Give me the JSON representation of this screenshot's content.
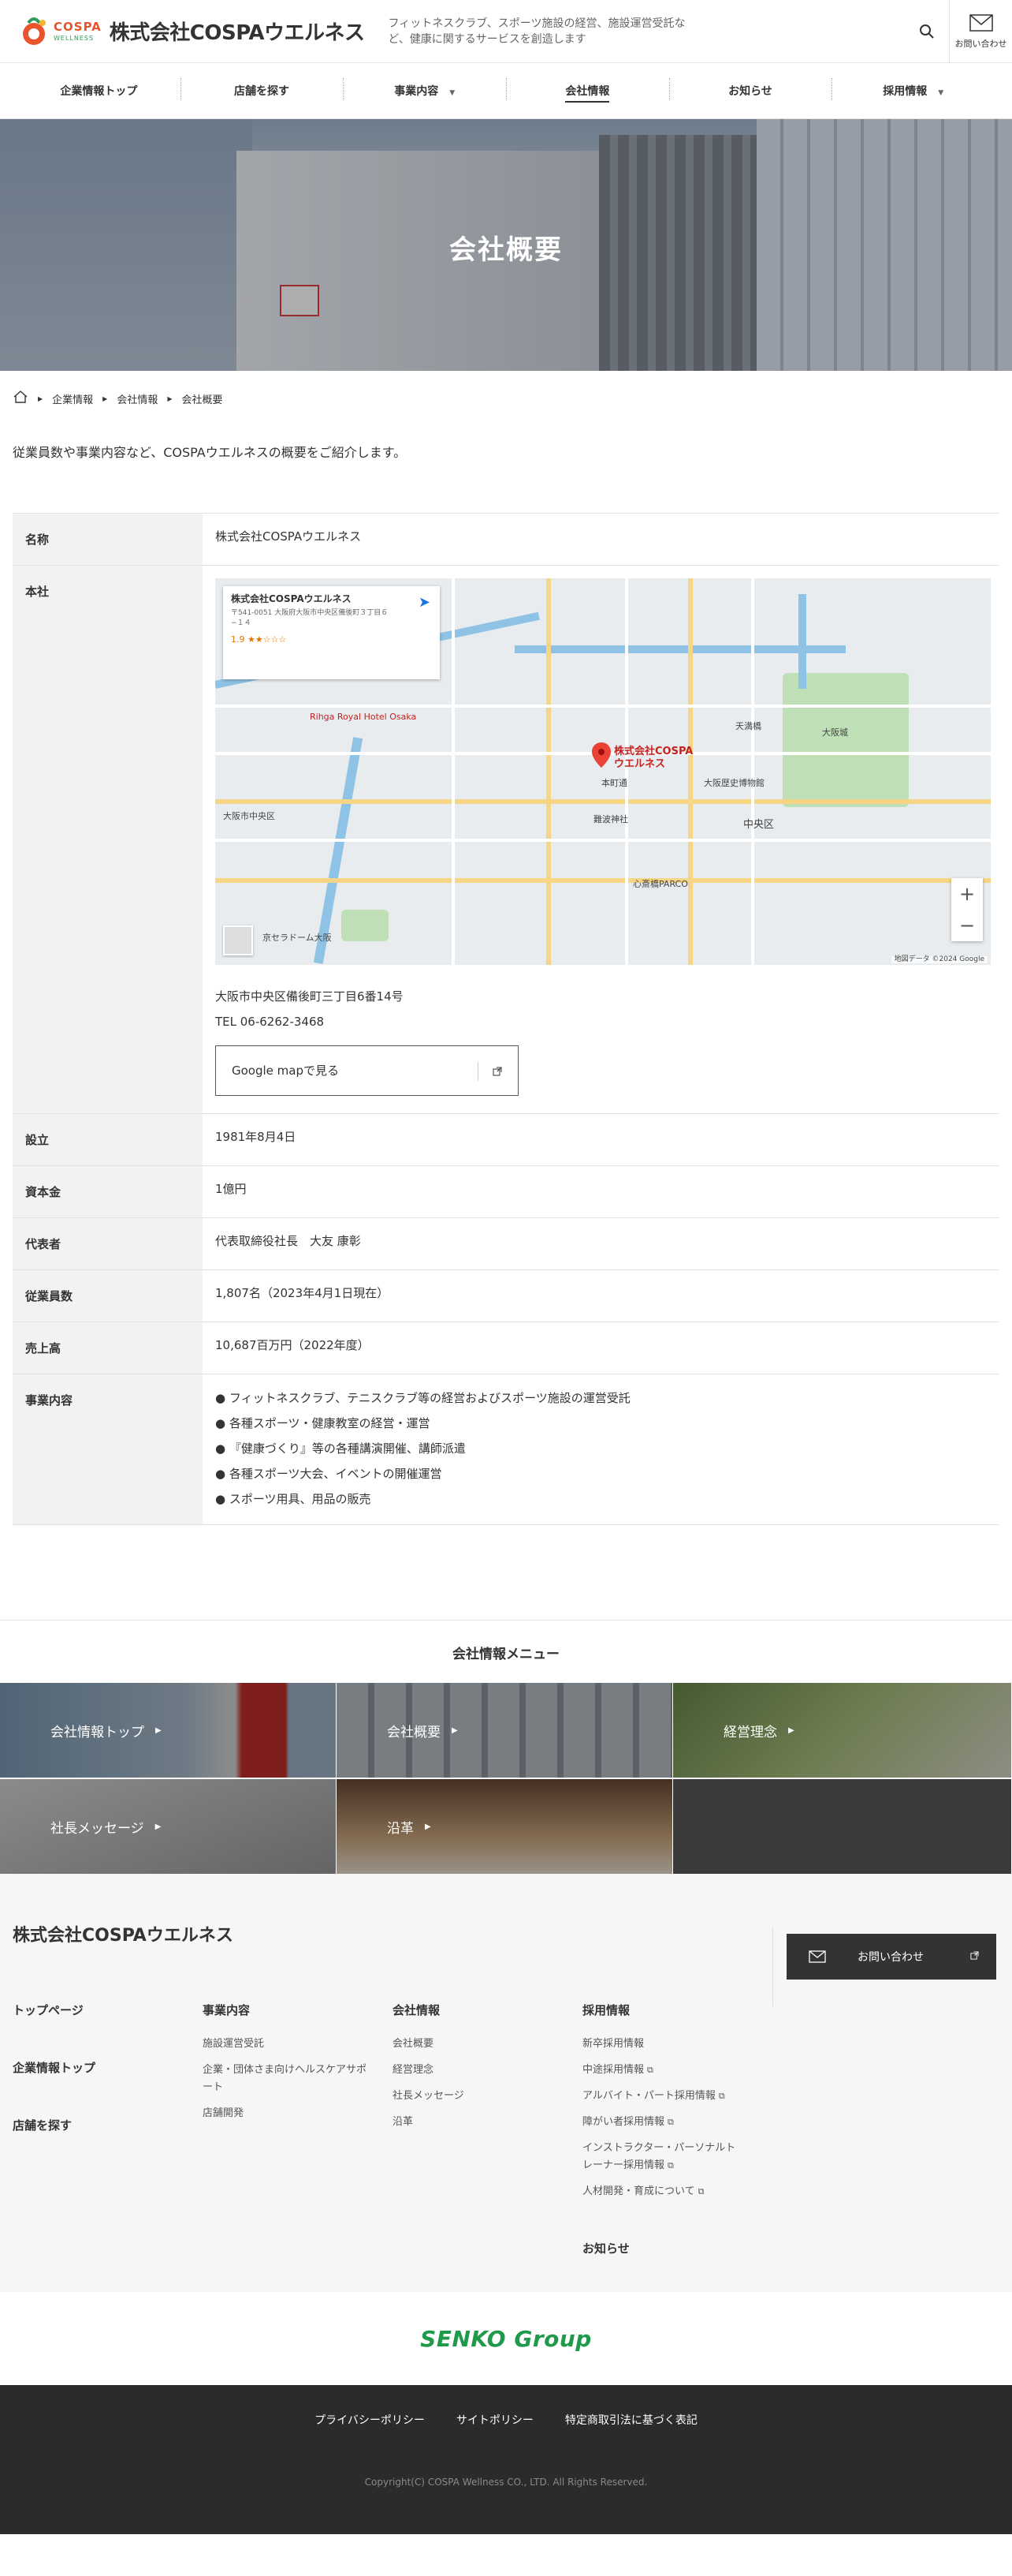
{
  "header": {
    "logo_cospa": "COSPA",
    "logo_wellness": "WELLNESS",
    "company_name": "株式会社COSPAウエルネス",
    "tagline": "フィットネスクラブ、スポーツ施設の経営、施設運営受託など、健康に関するサービスを創造します",
    "contact_label": "お問い合わせ"
  },
  "nav": [
    {
      "label": "企業情報トップ"
    },
    {
      "label": "店舗を探す"
    },
    {
      "label": "事業内容"
    },
    {
      "label": "会社情報"
    },
    {
      "label": "お知らせ"
    },
    {
      "label": "採用情報"
    }
  ],
  "hero": {
    "title": "会社概要"
  },
  "breadcrumb": [
    "企業情報",
    "会社情報",
    "会社概要"
  ],
  "lead": "従業員数や事業内容など、COSPAウエルネスの概要をご紹介します。",
  "table": {
    "name_label": "名称",
    "name_value": "株式会社COSPAウエルネス",
    "hq_label": "本社",
    "address": "大阪市中央区備後町三丁目6番14号",
    "tel": "TEL 06-6262-3468",
    "gmap_button": "Google mapで見る",
    "established_label": "設立",
    "established_value": "1981年8月4日",
    "capital_label": "資本金",
    "capital_value": "1億円",
    "rep_label": "代表者",
    "rep_value": "代表取締役社長　大友 康彰",
    "employees_label": "従業員数",
    "employees_value": "1,807名（2023年4月1日現在）",
    "sales_label": "売上高",
    "sales_value": "10,687百万円（2022年度）",
    "business_label": "事業内容",
    "business_items": [
      "● フィットネスクラブ、テニスクラブ等の経営およびスポーツ施設の運営受託",
      "● 各種スポーツ・健康教室の経営・運営",
      "● 『健康づくり』等の各種講演開催、講師派遣",
      "● 各種スポーツ大会、イベントの開催運営",
      "● スポーツ用具、用品の販売"
    ]
  },
  "map": {
    "card_title": "株式会社COSPAウエルネス",
    "card_addr": "〒541-0051 大阪府大阪市中央区備後町３丁目６−１４",
    "card_rating": "1.9 ★★☆☆☆",
    "pin_label": "株式会社COSPA ウエルネス",
    "copyright": "地図データ ©2024 Google",
    "labels": [
      "大阪市中央区",
      "中央区",
      "天満橋",
      "大阪城",
      "本町通",
      "心斎橋PARCO",
      "Rihga Royal Hotel Osaka",
      "京セラドーム大阪",
      "大阪歴史博物館",
      "難波神社"
    ]
  },
  "menu": {
    "title": "会社情報メニュー",
    "items": [
      {
        "label": "会社情報トップ"
      },
      {
        "label": "会社概要"
      },
      {
        "label": "経営理念"
      },
      {
        "label": "社長メッセージ"
      },
      {
        "label": "沿革"
      }
    ]
  },
  "footer": {
    "company": "株式会社COSPAウエルネス",
    "contact": "お問い合わせ",
    "col1": [
      "トップページ",
      "企業情報トップ",
      "店舗を探す"
    ],
    "col2_title": "事業内容",
    "col2": [
      "施設運営受託",
      "企業・団体さま向けヘルスケアサポート",
      "店舗開発"
    ],
    "col3_title": "会社情報",
    "col3": [
      "会社概要",
      "経営理念",
      "社長メッセージ",
      "沿革"
    ],
    "col4_title": "採用情報",
    "col4": [
      "新卒採用情報",
      "中途採用情報",
      "アルバイト・パート採用情報",
      "障がい者採用情報",
      "インストラクター・パーソナルトレーナー採用情報",
      "人材開発・育成について"
    ],
    "news": "お知らせ"
  },
  "group": "SENKO Group",
  "bottom": {
    "links": [
      "プライバシーポリシー",
      "サイトポリシー",
      "特定商取引法に基づく表記"
    ],
    "copyright": "Copyright(C) COSPA Wellness CO., LTD. All Rights Reserved."
  },
  "colors": {
    "brand_orange": "#e8552c",
    "brand_green": "#2e9b5b",
    "senko_green": "#1f9a4a",
    "footer_dark": "#2b2b2b"
  }
}
